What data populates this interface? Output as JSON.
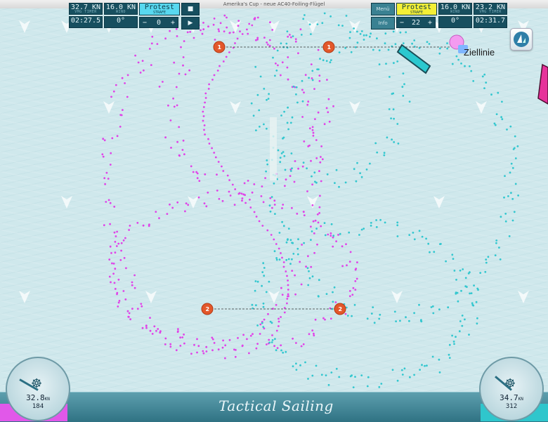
{
  "window": {
    "title": "Amerika's Cup - neue AC40-Foiling-Flügel"
  },
  "map": {
    "finish_label": "Ziellinie",
    "marks": {
      "top": "1",
      "bottom": "2"
    },
    "colors": {
      "magenta": "#e043e8",
      "cyan": "#33c7cf",
      "mark": "#e3572a"
    }
  },
  "dashboard": {
    "brand": "Tactical Sailing",
    "left": {
      "speed": "32.8",
      "speed_unit": "KN",
      "heading": "184",
      "vmg": "32.7 KN",
      "vmg_label": "VMG TIMER",
      "wind": "16.0 KN",
      "wind_label": "WIND",
      "timer": "02:27.5",
      "wind_angle": "0°",
      "protest": "Protest",
      "protest_sub": "STRAFE",
      "penalty": "0"
    },
    "right": {
      "speed": "34.7",
      "speed_unit": "KN",
      "heading": "312",
      "wind": "16.0 KN",
      "wind_label": "WIND",
      "vmg": "23.2 KN",
      "vmg_label": "VMG TIMER",
      "timer": "02:31.7",
      "wind_angle": "0°",
      "protest": "Protest",
      "protest_sub": "STRAFE",
      "penalty": "22"
    },
    "buttons": {
      "menu": "Menü",
      "info": "Info",
      "stop": "■",
      "play": "▶",
      "minus": "−",
      "plus": "+"
    }
  }
}
